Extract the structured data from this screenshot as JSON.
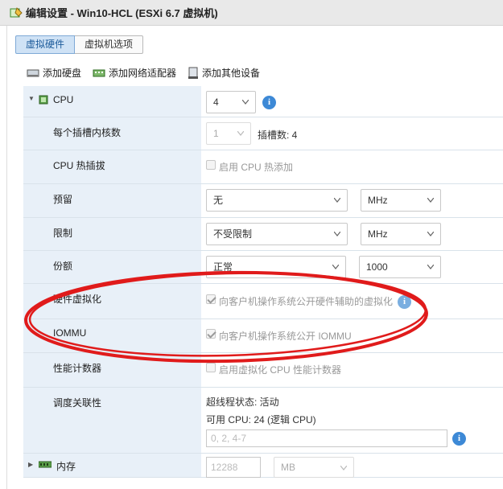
{
  "window": {
    "title": "编辑设置 - Win10-HCL (ESXi 6.7 虚拟机)",
    "icon": "vm-edit-icon"
  },
  "tabs": [
    {
      "label": "虚拟硬件",
      "active": true
    },
    {
      "label": "虚拟机选项",
      "active": false
    }
  ],
  "toolbar": {
    "add_disk": "添加硬盘",
    "add_nic": "添加网络适配器",
    "add_other": "添加其他设备"
  },
  "cpu": {
    "label": "CPU",
    "count": "4",
    "cores_label": "每个插槽内核数",
    "cores_value": "1",
    "sockets_text": "插槽数: 4",
    "hotplug_label": "CPU 热插拔",
    "hotplug_text": "启用 CPU 热添加",
    "reservation_label": "预留",
    "reservation_value": "无",
    "reservation_unit": "MHz",
    "limit_label": "限制",
    "limit_value": "不受限制",
    "limit_unit": "MHz",
    "shares_label": "份额",
    "shares_value": "正常",
    "shares_amount": "1000",
    "hv_label": "硬件虚拟化",
    "hv_text": "向客户机操作系统公开硬件辅助的虚拟化",
    "iommu_label": "IOMMU",
    "iommu_text": "向客户机操作系统公开 IOMMU",
    "perf_label": "性能计数器",
    "perf_text": "启用虚拟化 CPU 性能计数器",
    "affinity_label": "调度关联性",
    "ht_status": "超线程状态: 活动",
    "available_cpu": "可用 CPU: 24 (逻辑 CPU)",
    "affinity_placeholder": "0, 2, 4-7"
  },
  "memory": {
    "label": "内存",
    "value": "12288",
    "unit": "MB"
  },
  "colors": {
    "label_bg": "#e8f0f8",
    "accent": "#3d89d6",
    "annotation": "#e01b1b"
  }
}
